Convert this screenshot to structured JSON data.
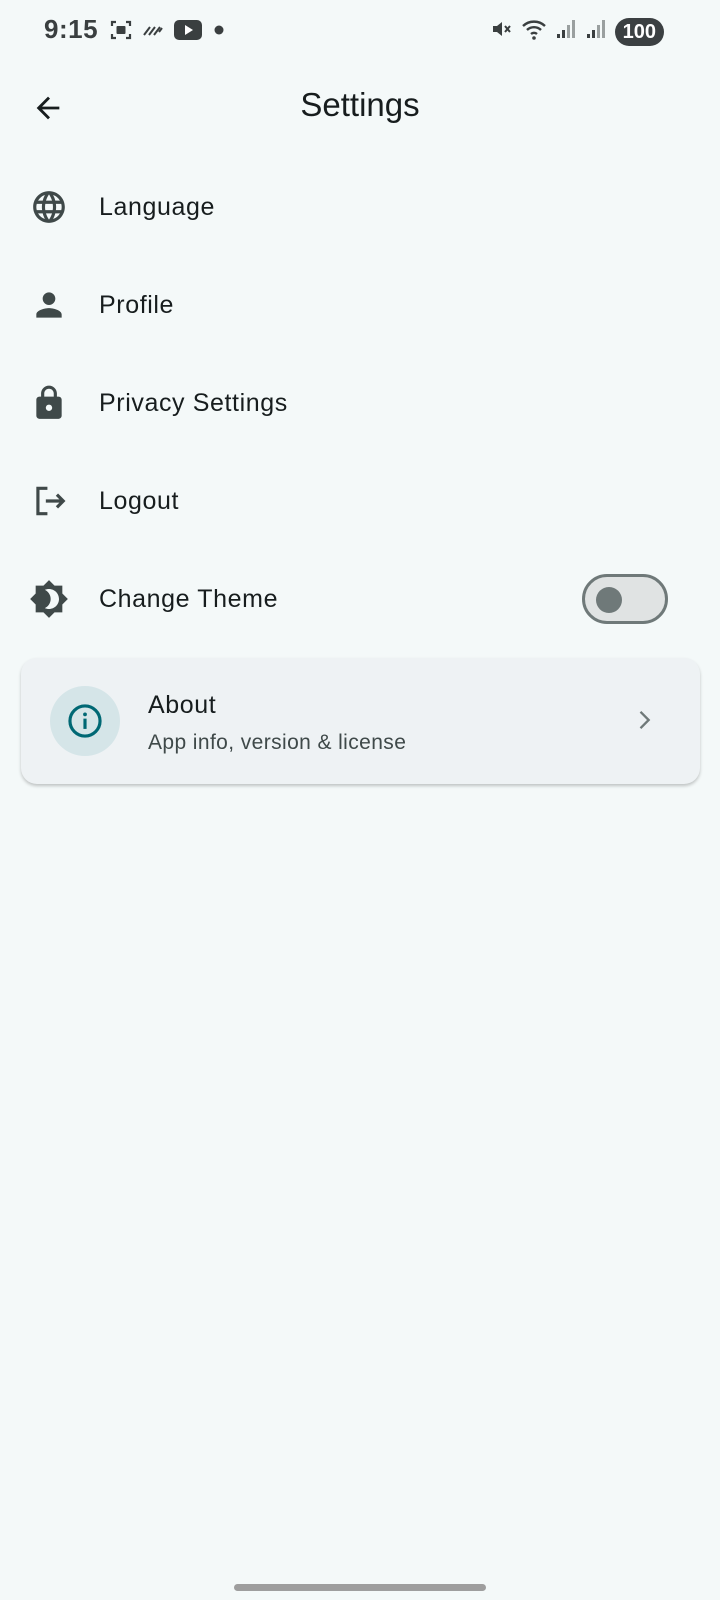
{
  "status_bar": {
    "time": "9:15",
    "battery": "100",
    "icons_left": [
      "screenshot-icon",
      "stylus-icon",
      "youtube-icon",
      "dot-icon"
    ],
    "icons_right": [
      "mute-icon",
      "wifi-icon",
      "signal-icon",
      "signal-icon"
    ]
  },
  "app_bar": {
    "title": "Settings",
    "back_icon": "arrow-back-icon"
  },
  "settings": {
    "items": [
      {
        "label": "Language",
        "icon": "globe-icon"
      },
      {
        "label": "Profile",
        "icon": "person-icon"
      },
      {
        "label": "Privacy Settings",
        "icon": "lock-icon"
      },
      {
        "label": "Logout",
        "icon": "logout-icon"
      },
      {
        "label": "Change Theme",
        "icon": "brightness-icon",
        "toggle": false
      }
    ]
  },
  "about": {
    "title": "About",
    "subtitle": "App info, version & license",
    "icon": "info-icon",
    "chevron": "chevron-right-icon"
  },
  "colors": {
    "background": "#f4f9f9",
    "accent": "#006874",
    "icon": "#3f4949",
    "card": "#eef2f4"
  }
}
